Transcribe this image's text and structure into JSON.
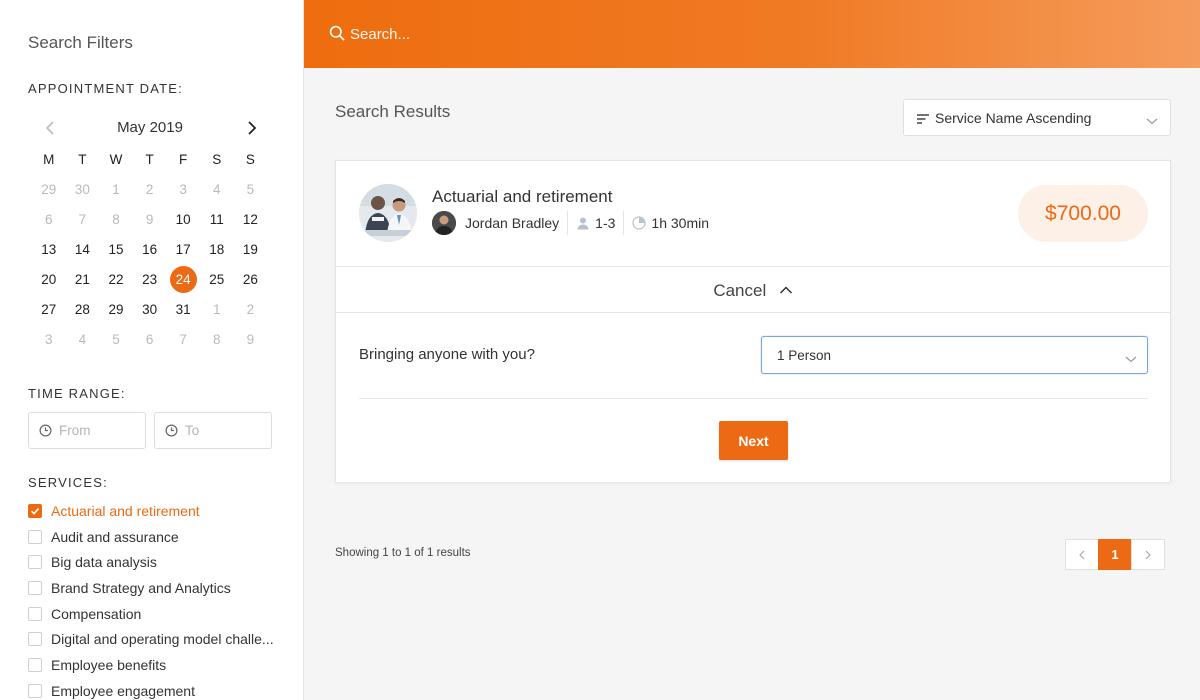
{
  "sidebar": {
    "title": "Search Filters",
    "appointment_label": "APPOINTMENT DATE:",
    "calendar": {
      "month": "May 2019",
      "weekdays": [
        "M",
        "T",
        "W",
        "T",
        "F",
        "S",
        "S"
      ],
      "weeks": [
        [
          "29",
          "30",
          "1",
          "2",
          "3",
          "4",
          "5"
        ],
        [
          "6",
          "7",
          "8",
          "9",
          "10",
          "11",
          "12"
        ],
        [
          "13",
          "14",
          "15",
          "16",
          "17",
          "18",
          "19"
        ],
        [
          "20",
          "21",
          "22",
          "23",
          "24",
          "25",
          "26"
        ],
        [
          "27",
          "28",
          "29",
          "30",
          "31",
          "1",
          "2"
        ],
        [
          "3",
          "4",
          "5",
          "6",
          "7",
          "8",
          "9"
        ]
      ],
      "muted": [
        [
          1,
          1,
          1,
          1,
          1,
          1,
          1
        ],
        [
          1,
          1,
          1,
          1,
          0,
          0,
          0
        ],
        [
          0,
          0,
          0,
          0,
          0,
          0,
          0
        ],
        [
          0,
          0,
          0,
          0,
          0,
          0,
          0
        ],
        [
          0,
          0,
          0,
          0,
          0,
          1,
          1
        ],
        [
          1,
          1,
          1,
          1,
          1,
          1,
          1
        ]
      ],
      "selected": "24"
    },
    "time_range_label": "TIME RANGE:",
    "time_from_placeholder": "From",
    "time_to_placeholder": "To",
    "services_label": "SERVICES:",
    "services": [
      {
        "label": "Actuarial and retirement",
        "checked": true
      },
      {
        "label": "Audit and assurance",
        "checked": false
      },
      {
        "label": "Big data analysis",
        "checked": false
      },
      {
        "label": "Brand Strategy and Analytics",
        "checked": false
      },
      {
        "label": "Compensation",
        "checked": false
      },
      {
        "label": "Digital and operating model challe...",
        "checked": false
      },
      {
        "label": "Employee benefits",
        "checked": false
      },
      {
        "label": "Employee engagement",
        "checked": false
      }
    ]
  },
  "header": {
    "search_placeholder": "Search..."
  },
  "results": {
    "title": "Search Results",
    "sort_label": "Service Name Ascending",
    "card": {
      "service": "Actuarial and retirement",
      "staff": "Jordan Bradley",
      "capacity": "1-3",
      "duration": "1h 30min",
      "price": "$700.00",
      "cancel_label": "Cancel",
      "question": "Bringing anyone with you?",
      "people_value": "1 Person",
      "next_label": "Next"
    },
    "showing": "Showing 1 to 1 of 1 results",
    "page": "1"
  },
  "colors": {
    "accent": "#ec6a14",
    "price_bg": "#fdf0e7",
    "select_border": "#7aa7e0"
  },
  "icons": {
    "search": "search-icon",
    "clock": "clock-icon",
    "sort": "sort-icon",
    "user": "user-icon",
    "duration": "duration-icon"
  }
}
